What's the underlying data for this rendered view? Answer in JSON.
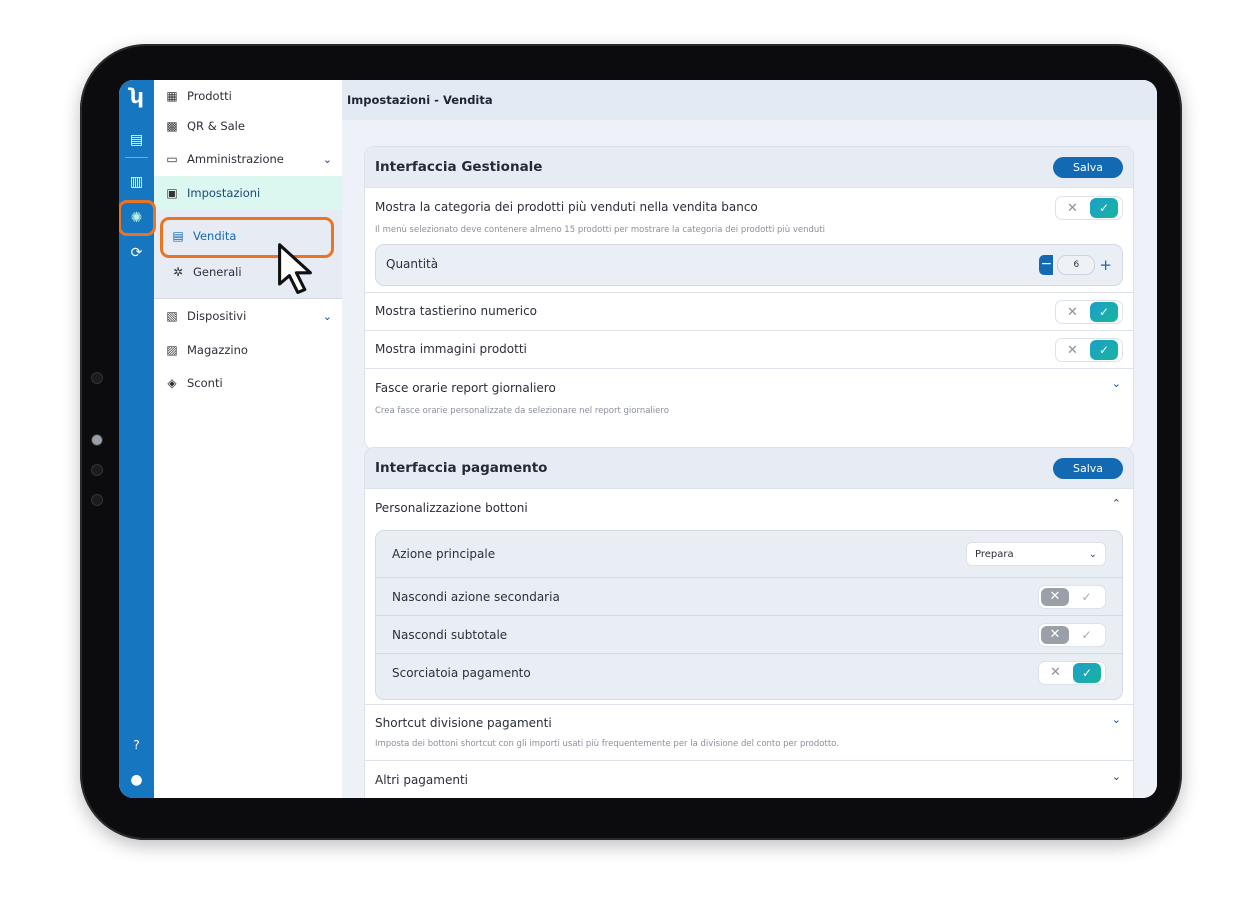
{
  "rail": {
    "icons": [
      "logo-icon",
      "receipt-icon",
      "chart-icon",
      "settings-icon",
      "cycle-icon",
      "help-icon",
      "user-icon"
    ]
  },
  "nav": {
    "items": [
      {
        "label": "Prodotti",
        "icon": "products-icon"
      },
      {
        "label": "QR & Sale",
        "icon": "qr-icon"
      },
      {
        "label": "Amministrazione",
        "icon": "admin-icon"
      },
      {
        "label": "Impostazioni",
        "icon": "settings-icon"
      },
      {
        "label": "Vendita",
        "icon": "sales-icon"
      },
      {
        "label": "Generali",
        "icon": "gear-icon"
      },
      {
        "label": "Dispositivi",
        "icon": "devices-icon"
      },
      {
        "label": "Magazzino",
        "icon": "warehouse-icon"
      },
      {
        "label": "Sconti",
        "icon": "discount-icon"
      }
    ]
  },
  "header": {
    "title": "Impostazioni - Vendita"
  },
  "gestionale": {
    "title": "Interfaccia Gestionale",
    "save": "Salva",
    "row1_label": "Mostra la categoria dei prodotti più venduti nella vendita banco",
    "row1_desc": "Il menù selezionato deve contenere almeno 15 prodotti per mostrare la categoria dei prodotti più venduti",
    "qty_label": "Quantità",
    "qty_value": "6",
    "row2_label": "Mostra tastierino numerico",
    "row3_label": "Mostra immagini prodotti",
    "row4_label": "Fasce orarie report giornaliero",
    "row4_desc": "Crea fasce orarie personalizzate da selezionare nel report giornaliero"
  },
  "pagamento": {
    "title": "Interfaccia pagamento",
    "save": "Salva",
    "section_label": "Personalizzazione bottoni",
    "action_label": "Azione principale",
    "action_value": "Prepara",
    "hide_secondary": "Nascondi azione secondaria",
    "hide_subtotal": "Nascondi subtotale",
    "payment_shortcut": "Scorciatoia pagamento",
    "split_label": "Shortcut divisione pagamenti",
    "split_desc": "Imposta dei bottoni shortcut con gli importi usati più frequentemente per la divisione del conto per prodotto.",
    "other_label": "Altri pagamenti"
  },
  "glyphs": {
    "x": "✕",
    "check": "✓",
    "chevron_down": "⌄",
    "chevron_up": "⌃",
    "minus": "−",
    "plus": "+"
  },
  "colors": {
    "accent": "#1469b3",
    "rail": "#1776c0",
    "highlight": "#e97524",
    "active_nav": "#dcf7ef",
    "toggle_on": "#17b49d"
  }
}
